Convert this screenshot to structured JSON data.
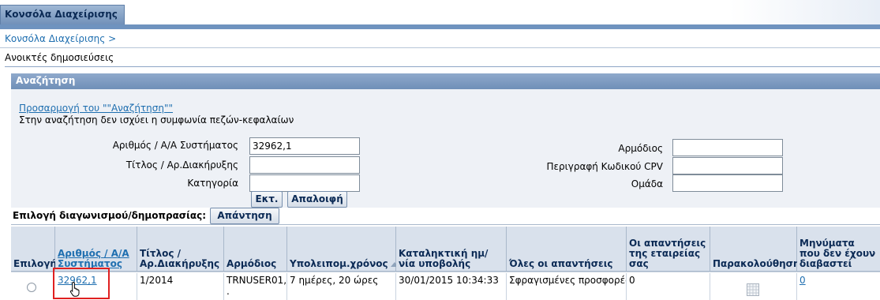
{
  "header": {
    "tab_label": "Κονσόλα Διαχείρισης"
  },
  "breadcrumb": {
    "item": "Κονσόλα Διαχείρισης",
    "separator": ">"
  },
  "page": {
    "title": "Ανοικτές δημοσιεύσεις"
  },
  "search": {
    "heading": "Αναζήτηση",
    "personalize_link": "Προσαρμογή του \"\"Αναζήτηση\"\"",
    "case_note": "Στην αναζήτηση δεν ισχύει η συμφωνία πεζών-κεφαλαίων",
    "fields": {
      "system_number_label": "Αριθμός / Α/Α Συστήματος",
      "system_number_value": "32962,1",
      "title_label": "Τίτλος / Αρ.Διακήρυξης",
      "title_value": "",
      "category_label": "Κατηγορία",
      "category_value": "",
      "owner_label": "Αρμόδιος",
      "owner_value": "",
      "cpv_label": "Περιγραφή Κωδικού CPV",
      "cpv_value": "",
      "group_label": "Ομάδα",
      "group_value": ""
    },
    "go_button": "Εκτ.",
    "clear_button": "Απαλοιφή"
  },
  "selection": {
    "label": "Επιλογή διαγωνισμού/δημοπρασίας:",
    "respond_button": "Απάντηση"
  },
  "table": {
    "columns": [
      "Επιλογή",
      "Αριθμός / Α/Α Συστήματος",
      "Τίτλος / Αρ.Διακήρυξης",
      "Αρμόδιος",
      "Υπολειπομ.χρόνος",
      "Καταληκτική ημ/νία υποβολής",
      "Όλες οι απαντήσεις",
      "Οι απαντήσεις της εταιρείας σας",
      "Παρακολούθηση",
      "Μηνύματα που δεν έχουν διαβαστεί"
    ],
    "rows": [
      {
        "number": "32962,1",
        "title": "1/2014",
        "owner": "TRNUSER01,",
        "owner_cont": ".",
        "remaining": "7 ημέρες, 20 ώρες",
        "deadline": "30/01/2015 10:34:33",
        "all_responses": "Σφραγισμένες προσφορές",
        "company_responses": "0",
        "unread": "0"
      }
    ]
  },
  "colors": {
    "header_blue": "#6f8fb8",
    "link_blue": "#1f6fb0",
    "highlight_red": "#e02020"
  }
}
